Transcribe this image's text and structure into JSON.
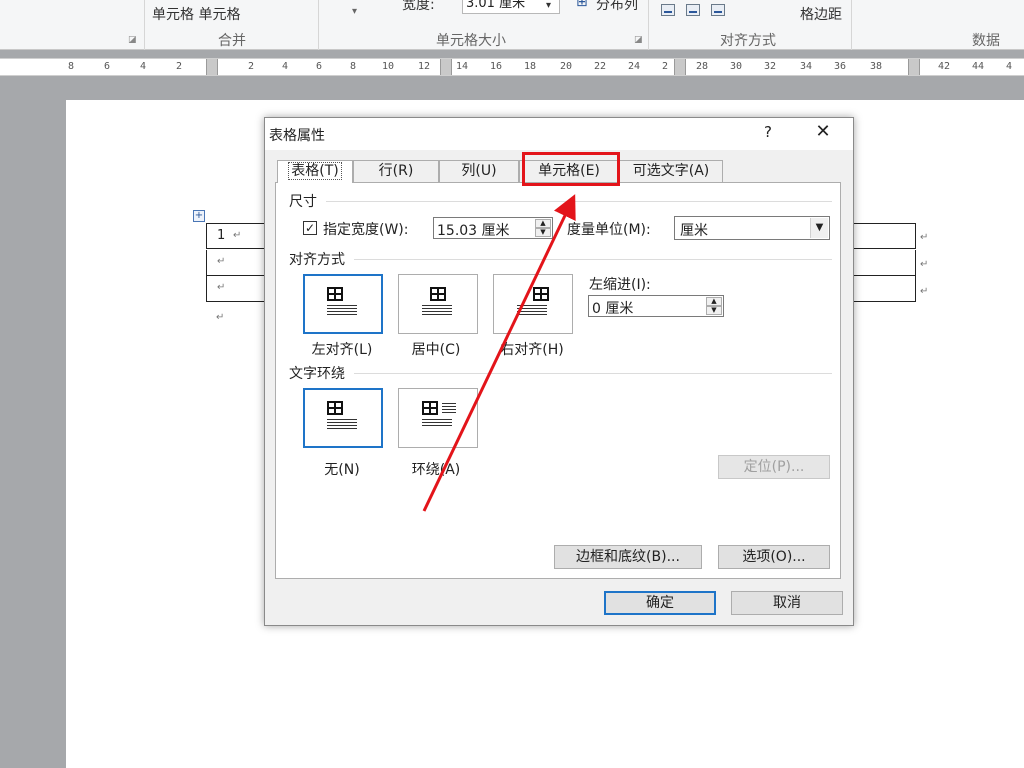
{
  "ribbon": {
    "merge_cells_text": "单元格 单元格",
    "width_label": "宽度:",
    "width_value": "3.01 厘米",
    "distribute_cols": "分布列",
    "cell_margins": "格边距",
    "groups": {
      "merge": "合并",
      "cell_size": "单元格大小",
      "alignment": "对齐方式",
      "data": "数据"
    }
  },
  "ruler": {
    "ticks": [
      "8",
      "6",
      "4",
      "2",
      "2",
      "4",
      "6",
      "8",
      "10",
      "12",
      "14",
      "16",
      "18",
      "20",
      "22",
      "24",
      "2",
      "28",
      "30",
      "32",
      "34",
      "36",
      "38",
      "42",
      "44",
      "4"
    ]
  },
  "document": {
    "cell_1": "1",
    "para_mark": "↵"
  },
  "dialog": {
    "title": "表格属性",
    "help": "?",
    "close": "✕",
    "tabs": [
      {
        "label": "表格(T)"
      },
      {
        "label": "行(R)"
      },
      {
        "label": "列(U)"
      },
      {
        "label": "单元格(E)"
      },
      {
        "label": "可选文字(A)"
      }
    ],
    "size_section": "尺寸",
    "preferred_width_label": "指定宽度(W):",
    "preferred_width_checked": "✓",
    "preferred_width_value": "15.03 厘米",
    "measure_in_label": "度量单位(M):",
    "measure_in_value": "厘米",
    "alignment_section": "对齐方式",
    "align_left": "左对齐(L)",
    "align_center": "居中(C)",
    "align_right": "右对齐(H)",
    "indent_label": "左缩进(I):",
    "indent_value": "0 厘米",
    "wrap_section": "文字环绕",
    "wrap_none": "无(N)",
    "wrap_around": "环绕(A)",
    "positioning_button": "定位(P)...",
    "borders_button": "边框和底纹(B)...",
    "options_button": "选项(O)...",
    "ok_button": "确定",
    "cancel_button": "取消"
  },
  "annotation": {
    "highlight_color": "#e3141a"
  }
}
